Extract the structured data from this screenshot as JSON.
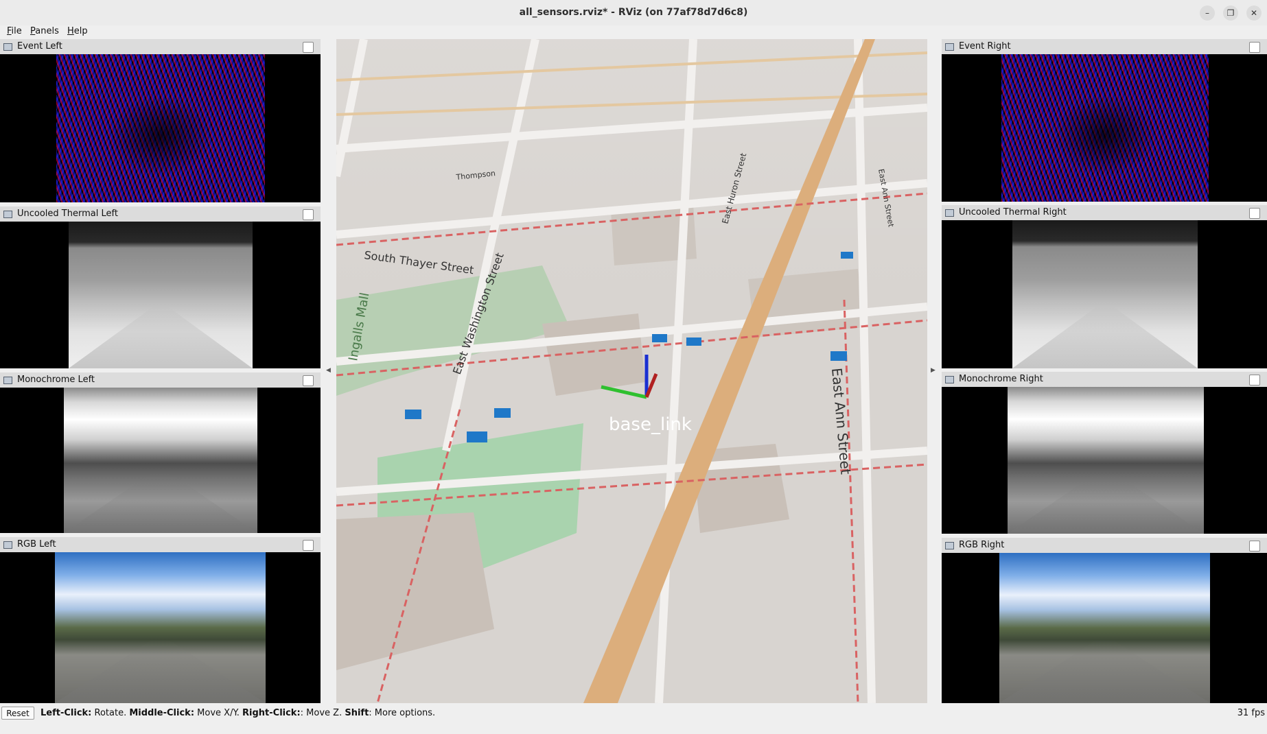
{
  "window": {
    "title": "all_sensors.rviz* - RViz (on 77af78d7d6c8)",
    "controls": [
      "minimize-icon",
      "restore-icon",
      "close-icon"
    ]
  },
  "menu": [
    "File",
    "Panels",
    "Help"
  ],
  "panels_left": [
    {
      "title": "Event Left",
      "kind": "event"
    },
    {
      "title": "Uncooled Thermal Left",
      "kind": "thermal"
    },
    {
      "title": "Monochrome Left",
      "kind": "mono"
    },
    {
      "title": "RGB Left",
      "kind": "rgb"
    }
  ],
  "panels_right": [
    {
      "title": "Event Right",
      "kind": "event"
    },
    {
      "title": "Uncooled Thermal Right",
      "kind": "thermal"
    },
    {
      "title": "Monochrome Right",
      "kind": "mono"
    },
    {
      "title": "RGB Right",
      "kind": "rgb"
    }
  ],
  "render_view": {
    "frame_label": "base_link",
    "street_labels": [
      "South Thayer Street",
      "East Washington Street",
      "East Ann Street",
      "East Huron Street",
      "Thompson",
      "East Ann Street",
      "Ingalls Mall"
    ]
  },
  "status": {
    "reset_label": "Reset",
    "hint_parts": [
      {
        "bold": "Left-Click:",
        "text": " Rotate. "
      },
      {
        "bold": "Middle-Click:",
        "text": " Move X/Y. "
      },
      {
        "bold": "Right-Click:",
        "text": ": Move Z. "
      },
      {
        "bold": "Shift",
        "text": ": More options."
      }
    ],
    "fps": "31 fps"
  }
}
